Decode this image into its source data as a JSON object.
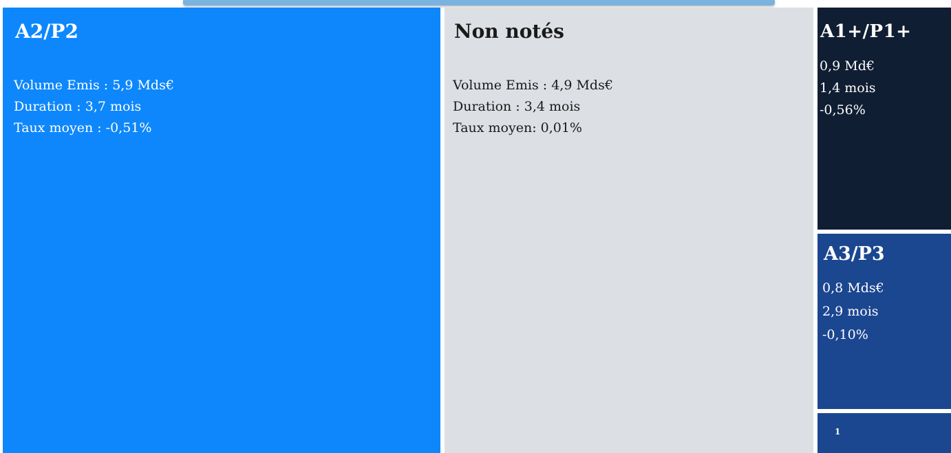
{
  "chart_data": {
    "type": "treemap",
    "tiles": [
      {
        "id": "a2",
        "label": "A2/P2",
        "lines": [
          "Volume Emis : 5,9 Mds€",
          "Duration :  3,7 mois",
          "Taux moyen : -0,51%"
        ],
        "volume": 5.9,
        "color": "#0e87fc"
      },
      {
        "id": "nn",
        "label": "Non notés",
        "lines": [
          "Volume Emis : 4,9 Mds€",
          "Duration : 3,4 mois",
          "Taux moyen: 0,01%"
        ],
        "volume": 4.9,
        "color": "#dcdfe3"
      },
      {
        "id": "a1",
        "label": "A1+/P1+",
        "lines": [
          "0,9 Md€",
          "1,4 mois",
          "-0,56%"
        ],
        "volume": 0.9,
        "color": "#101e33"
      },
      {
        "id": "a3",
        "label": "A3/P3",
        "lines": [
          "0,8 Mds€",
          "2,9 mois",
          "-0,10%"
        ],
        "volume": 0.8,
        "color": "#1b4690"
      },
      {
        "id": "t1",
        "label": "1",
        "lines": [],
        "color": "#1b4690"
      }
    ]
  }
}
